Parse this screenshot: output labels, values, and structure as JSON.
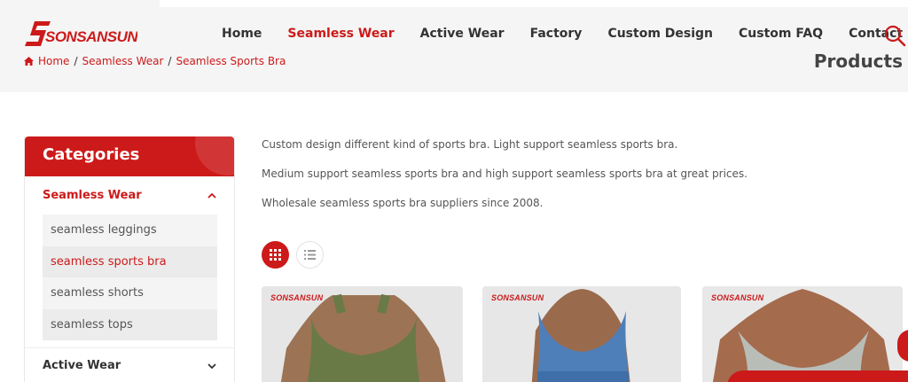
{
  "brand": {
    "name": "SONSANSUN"
  },
  "nav": {
    "items": [
      {
        "label": "Home",
        "active": false
      },
      {
        "label": "Seamless Wear",
        "active": true
      },
      {
        "label": "Active Wear",
        "active": false
      },
      {
        "label": "Factory",
        "active": false
      },
      {
        "label": "Custom Design",
        "active": false
      },
      {
        "label": "Custom FAQ",
        "active": false
      },
      {
        "label": "Contact Us",
        "active": false
      }
    ],
    "search_icon": "search-icon"
  },
  "breadcrumb": {
    "home": "Home",
    "sep": "/",
    "level1": "Seamless Wear",
    "level2": "Seamless Sports Bra"
  },
  "page_title": "Products",
  "sidebar": {
    "title": "Categories",
    "groups": [
      {
        "label": "Seamless Wear",
        "expanded": true,
        "items": [
          {
            "label": "seamless leggings",
            "active": false
          },
          {
            "label": "seamless sports bra",
            "active": true
          },
          {
            "label": "seamless shorts",
            "active": false
          },
          {
            "label": "seamless tops",
            "active": false
          }
        ]
      },
      {
        "label": "Active Wear",
        "expanded": false
      }
    ]
  },
  "description": [
    "Custom design different kind of sports bra. Light support seamless sports bra.",
    "Medium support seamless sports bra and high support seamless sports bra at great prices.",
    "Wholesale seamless sports bra suppliers since 2008."
  ],
  "view_modes": {
    "grid": "grid-view-icon",
    "list": "list-view-icon",
    "active": "grid"
  },
  "products": [
    {
      "brand": "SONSANSUN",
      "color": "#6a7a47"
    },
    {
      "brand": "SONSANSUN",
      "color": "#4f7fb8"
    },
    {
      "brand": "SONSANSUN",
      "color": "#b9bdb8"
    }
  ],
  "colors": {
    "accent": "#cc1a1a",
    "text": "#333333"
  }
}
